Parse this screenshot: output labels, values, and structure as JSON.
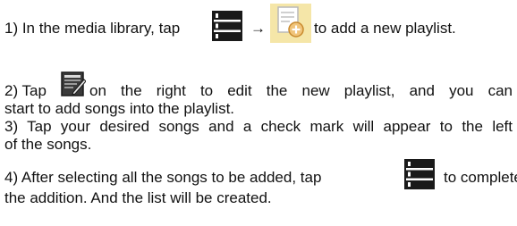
{
  "steps": [
    {
      "before": "1) In the media library, tap",
      "arrow": "→",
      "after": "to add a new playlist."
    },
    {
      "before": "2) Tap",
      "after": "on the right to edit the new playlist, and you can",
      "line2": "start to add songs into the playlist."
    },
    {
      "line1": "3) Tap your desired songs and a check mark will appear to the left",
      "line2": "of the songs."
    },
    {
      "before": "4) After selecting all the songs to be added, tap",
      "after": "to complete",
      "line2": "the addition.  And the list will be created."
    }
  ],
  "icons": {
    "menu": "list-menu-icon",
    "add_playlist": "add-playlist-icon",
    "edit": "edit-icon"
  },
  "colors": {
    "icon_dark": "#1a1a1a",
    "icon_add_bg": "#f5e6a8",
    "icon_edit_bg": "#3a3a3a",
    "text": "#111111"
  }
}
